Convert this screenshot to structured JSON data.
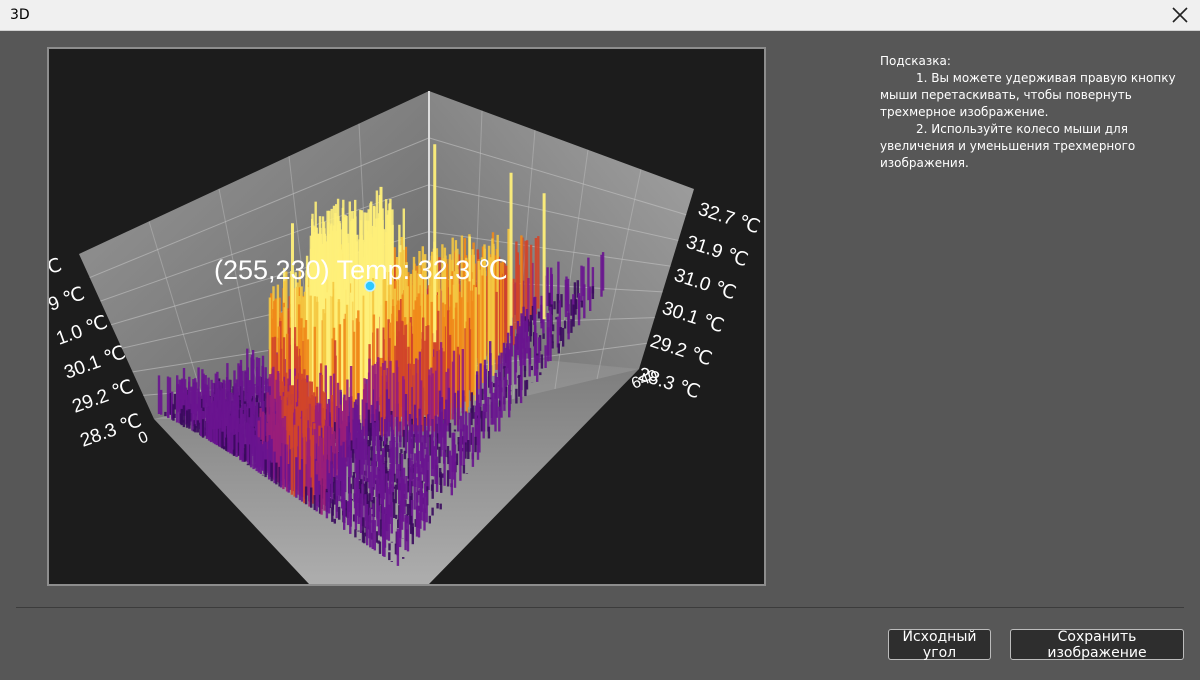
{
  "window": {
    "title": "3D"
  },
  "plot": {
    "tooltip": "(255,230) Temp: 32.3 ℃",
    "right_axis_labels": [
      "32.7 ℃",
      "31.9 ℃",
      "31.0 ℃",
      "30.1 ℃",
      "29.2 ℃",
      "28.3 ℃"
    ],
    "left_axis_labels": [
      "℃",
      "9 ℃",
      "1.0 ℃",
      "30.1 ℃",
      "29.2 ℃",
      "28.3 ℃"
    ],
    "x_axis_min_label": "0",
    "x_axis_max_label": "640",
    "colormap": [
      "#3a0a5e",
      "#6a1490",
      "#9a1e7a",
      "#d2452a",
      "#f08a1a",
      "#f5c842",
      "#fff07a"
    ]
  },
  "hint": {
    "heading": "Подсказка:",
    "item1": "1. Вы можете удерживая правую кнопку мыши перетаскивать, чтобы повернуть трехмерное изображение.",
    "item2": "2. Используйте колесо мыши для увеличения и уменьшения трехмерного изображения."
  },
  "buttons": {
    "reset": "Исходный угол",
    "save": "Сохранить изображение"
  }
}
